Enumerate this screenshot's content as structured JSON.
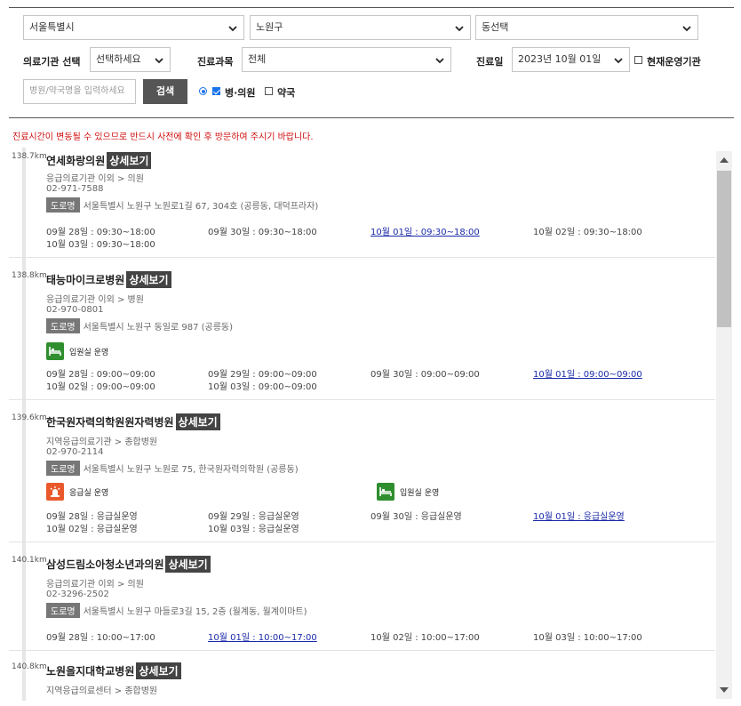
{
  "filters": {
    "region": "서울특별시",
    "district": "노원구",
    "dong": "동선택",
    "facility_label": "의료기관 선택",
    "facility_value": "선택하세요",
    "dept_label": "진료과목",
    "dept_value": "전체",
    "date_label": "진료일",
    "date_value": "2023년 10월 01일",
    "open_now_label": "현재운영기관",
    "search_placeholder": "병원/약국명을 입력하세요",
    "search_button": "검색",
    "type_hospital": "병·의원",
    "type_pharmacy": "약국"
  },
  "notice": "진료시간이 변동될 수 있으므로 반드시 사전에 확인 후 방문하여 주시기 바랍니다.",
  "detail_label": "상세보기",
  "road_label": "도로명",
  "entries": [
    {
      "distance": "138.7km",
      "name": "연세화랑의원",
      "category": "응급의료기관 이외 > 의원",
      "phone": "02-971-7588",
      "address": "서울특별시 노원구 노원로1길 67, 304호 (공릉동, 대덕프라자)",
      "hours": [
        "09월 28일 : 09:30~18:00",
        "09월 30일 : 09:30~18:00",
        "10월 01일 : 09:30~18:00",
        "10월 02일 : 09:30~18:00",
        "10월 03일 : 09:30~18:00"
      ]
    },
    {
      "distance": "138.8km",
      "name": "태능마이크로병원",
      "category": "응급의료기관 이외 > 병원",
      "phone": "02-970-0801",
      "address": "서울특별시 노원구 동일로 987 (공릉동)",
      "services": [
        "입원실 운영"
      ],
      "hours": [
        "09월 28일 : 09:00~09:00",
        "09월 29일 : 09:00~09:00",
        "09월 30일 : 09:00~09:00",
        "10월 01일 : 09:00~09:00",
        "10월 02일 : 09:00~09:00",
        "10월 03일 : 09:00~09:00"
      ]
    },
    {
      "distance": "139.6km",
      "name": "한국원자력의학원원자력병원",
      "category": "지역응급의료기관 > 종합병원",
      "phone": "02-970-2114",
      "address": "서울특별시 노원구 노원로 75, 한국원자력의학원 (공릉동)",
      "services": [
        "응급실 운영",
        "입원실 운영"
      ],
      "hours": [
        "09월 28일 : 응급실운영",
        "09월 29일 : 응급실운영",
        "09월 30일 : 응급실운영",
        "10월 01일 : 응급실운영",
        "10월 02일 : 응급실운영",
        "10월 03일 : 응급실운영"
      ]
    },
    {
      "distance": "140.1km",
      "name": "삼성드림소아청소년과의원",
      "category": "응급의료기관 이외 > 의원",
      "phone": "02-3296-2502",
      "address": "서울특별시 노원구 마들로3길 15, 2층 (월계동, 월계이마트)",
      "hours": [
        "09월 28일 : 10:00~17:00",
        "10월 01일 : 10:00~17:00",
        "10월 02일 : 10:00~17:00",
        "10월 03일 : 10:00~17:00"
      ]
    },
    {
      "distance": "140.8km",
      "name": "노원을지대학교병원",
      "category": "지역응급의료센터 > 종합병원"
    }
  ]
}
